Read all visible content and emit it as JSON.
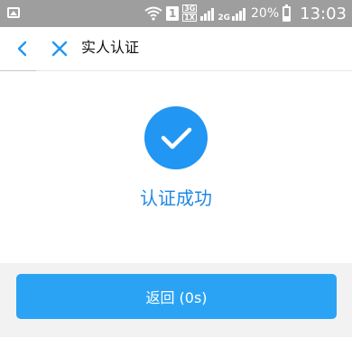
{
  "status_bar": {
    "sim_slot": "1",
    "network_top": "3G",
    "network_bottom": "1X",
    "network_2g": "2G",
    "battery": "20%",
    "time": "13:03"
  },
  "nav": {
    "title": "实人认证",
    "back_icon": "chevron-left-icon",
    "close_icon": "close-icon"
  },
  "result": {
    "icon": "checkmark-icon",
    "message": "认证成功"
  },
  "footer": {
    "return_label": "返回 (0s)"
  },
  "colors": {
    "status_bar_bg": "#9e9e9e",
    "accent": "#2196f3",
    "button": "#2aa3f5",
    "footer_bg": "#f2f2f2"
  }
}
